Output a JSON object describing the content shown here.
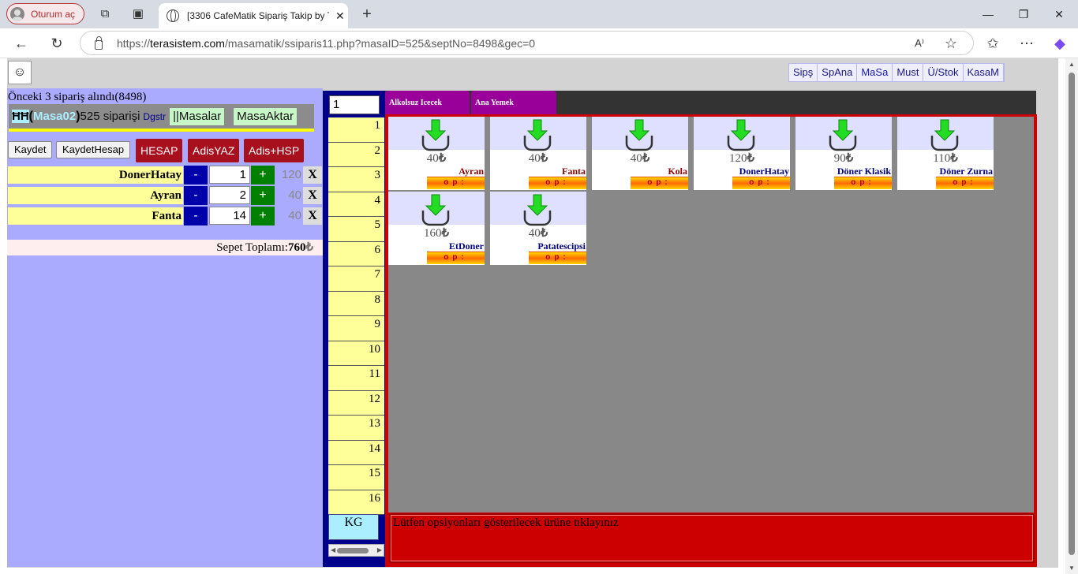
{
  "browser": {
    "profile_label": "Oturum aç",
    "tab_title": "[3306 CafeMatik Sipariş Takip by T",
    "url_prefix": "https://",
    "url_host": "terasistem.com",
    "url_path": "/masamatik/ssiparis11.php?masaID=525&septNo=8498&gec=0"
  },
  "topnav": [
    "Sipş",
    "SpAna",
    "MaSa",
    "Must",
    "Ü/Stok",
    "KasaM"
  ],
  "left": {
    "prev_msg": "Önceki 3 sipariş alındı(8498)",
    "table_icon": "ĦĦ",
    "table_name": "Masa02",
    "order_text": "525 siparişi",
    "dgstr": "Dgstr",
    "masalar_btn": "||Masalar",
    "masaaktar_btn": "MasaAktar",
    "buttons": {
      "kaydet": "Kaydet",
      "kaydethesap": "KaydetHesap",
      "hesap": "HESAP",
      "adisyaz": "AdisYAZ",
      "adishsp": "Adis+HSP"
    },
    "orders": [
      {
        "name": "DonerHatay",
        "qty": "1",
        "price": "120"
      },
      {
        "name": "Ayran",
        "qty": "2",
        "price": "40"
      },
      {
        "name": "Fanta",
        "qty": "14",
        "price": "40"
      }
    ],
    "minus": "-",
    "plus": "+",
    "del": "X",
    "total_label": "Sepet Toplamı:",
    "total_value": "760",
    "currency": "₺"
  },
  "numbers": {
    "input_value": "1",
    "rows": [
      "1",
      "2",
      "3",
      "4",
      "5",
      "6",
      "7",
      "8",
      "9",
      "10",
      "11",
      "12",
      "13",
      "14",
      "15",
      "16"
    ],
    "kg": "KG"
  },
  "categories": [
    "Alkolsuz Icecek",
    "Ana Yemek"
  ],
  "products": [
    {
      "name": "Ayran",
      "price": "40",
      "color": "#8b0000"
    },
    {
      "name": "Fanta",
      "price": "40",
      "color": "#8b0000"
    },
    {
      "name": "Kola",
      "price": "40",
      "color": "#8b0000"
    },
    {
      "name": "DonerHatay",
      "price": "120",
      "color": "#000080"
    },
    {
      "name": "Döner Klasik",
      "price": "90",
      "color": "#000080"
    },
    {
      "name": "Döner Zurna",
      "price": "110",
      "color": "#000080"
    },
    {
      "name": "EtDoner",
      "price": "160",
      "color": "#000080"
    },
    {
      "name": "Patatescipsi",
      "price": "40",
      "color": "#000080"
    }
  ],
  "option_label": "op:",
  "message": "Lütfen opsiyonları gösterilecek ürüne tıklayınız"
}
